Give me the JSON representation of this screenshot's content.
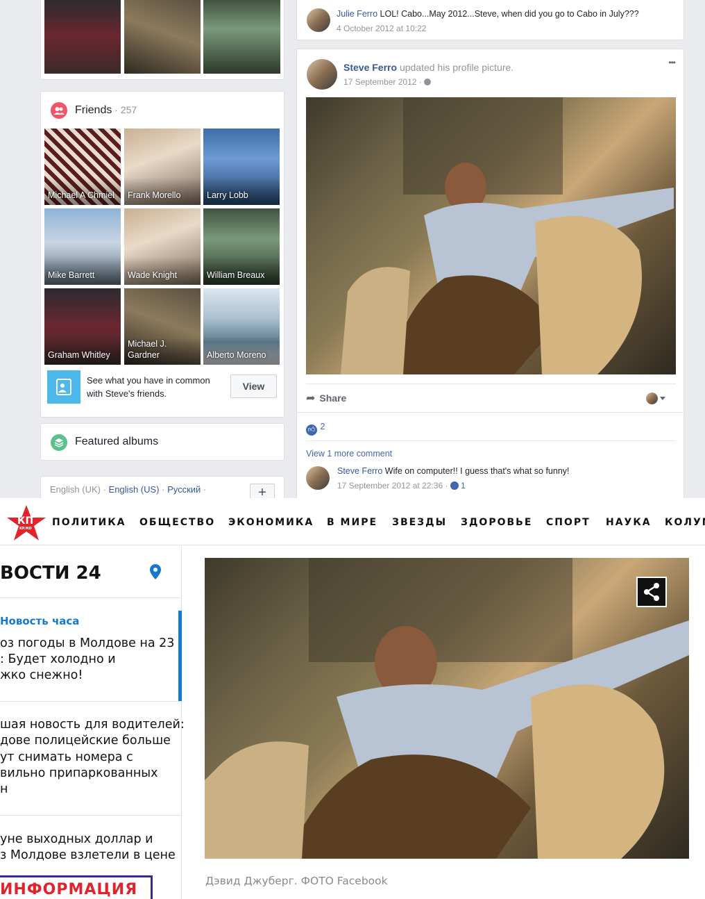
{
  "facebook": {
    "top_comment": {
      "author": "Julie Ferro",
      "text": "LOL! Cabo...May 2012...Steve, when did you go to Cabo in July???",
      "timestamp": "4 October 2012 at 10:22"
    },
    "friends": {
      "title": "Friends",
      "count": "257",
      "items": [
        {
          "name": "Michael A Chmiel"
        },
        {
          "name": "Frank Morello"
        },
        {
          "name": "Larry Lobb"
        },
        {
          "name": "Mike Barrett"
        },
        {
          "name": "Wade Knight"
        },
        {
          "name": "William Breaux"
        },
        {
          "name": "Graham Whitley"
        },
        {
          "name": "Michael J. Gardner"
        },
        {
          "name": "Alberto Moreno"
        }
      ],
      "common_text": "See what you have in common with Steve's friends.",
      "view_label": "View"
    },
    "featured_albums": "Featured albums",
    "languages": {
      "current": "English (UK)",
      "links": [
        "English (US)",
        "Русский"
      ]
    },
    "post": {
      "author": "Steve Ferro",
      "action": "updated his profile picture.",
      "date": "17 September 2012",
      "more": "•••",
      "share_label": "Share",
      "like_count": "2",
      "view_more_comments": "View 1 more comment",
      "comment": {
        "author": "Steve Ferro",
        "text": "Wife on computer!! I guess that's what so funny!",
        "timestamp": "17 September 2012 at 22:36",
        "likes": "1"
      }
    }
  },
  "kp": {
    "logo_text": "КП",
    "logo_subtext": "KP.MD",
    "nav": [
      "ПОЛИТИКА",
      "ОБЩЕСТВО",
      "ЭКОНОМИКА",
      "В МИРЕ",
      "ЗВЕЗДЫ",
      "ЗДОРОВЬЕ",
      "СПОРТ",
      "НАУКА",
      "КОЛУМ"
    ],
    "sidebar": {
      "title": "ВОСТИ 24",
      "hour_label": "Новость часа",
      "news": [
        {
          "lines": [
            "оз погоды в Молдове на 23",
            ": Будет холодно и",
            "жко снежно!"
          ]
        },
        {
          "lines": [
            "шая новость для водителей:",
            "дове полицейские больше",
            "ут снимать номера с",
            "вильно припаркованных",
            "н"
          ]
        },
        {
          "lines": [
            "уне выходных доллар и",
            "з Молдове взлетели в цене"
          ]
        }
      ],
      "info_banner": "ИНФОРМАЦИЯ"
    },
    "caption": "Дэвид Джуберг. ФОТО Facebook"
  },
  "colors": {
    "fb_blue": "#365899",
    "fb_bg": "#e9ebee",
    "kp_red": "#e1232b",
    "kp_blue": "#1479d0"
  }
}
